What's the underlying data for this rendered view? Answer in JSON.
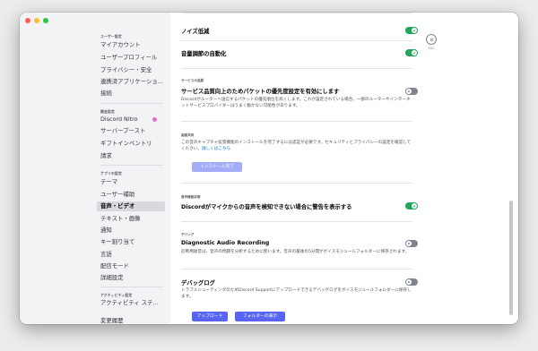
{
  "sidebar": {
    "user_settings_header": "ユーザー設定",
    "user_items": [
      "マイアカウント",
      "ユーザープロフィール",
      "プライバシー・安全",
      "連携済アプリケーショ...",
      "接続"
    ],
    "billing_header": "課金設定",
    "billing_items": [
      "Discord Nitro",
      "サーバーブースト",
      "ギフトインベントリ",
      "請求"
    ],
    "app_header": "アプリの設定",
    "app_items": [
      "テーマ",
      "ユーザー補助",
      "音声・ビデオ",
      "テキスト・画像",
      "通知",
      "キー割り当て",
      "言語",
      "配信モード",
      "詳細設定"
    ],
    "activity_header": "アクティビティ設定",
    "activity_items": [
      "アクティビティ ステ..."
    ],
    "bottom_item": "変更履歴"
  },
  "settings": {
    "noise_reduction": "ノイズ低減",
    "auto_gain": "音量調節の自動化",
    "qos_header": "サービスの品質",
    "qos_title": "サービス品質向上のためパケットの優先度設定を有効にします",
    "qos_desc": "Discordがルーターへ送信するパケットの優先順位を高くします。これが設定されている場合、一部のルーターやインターネットサービスプロバイダーはうまく動かない可能性があります。",
    "capture_header": "画面共有",
    "capture_desc": "この音声キャプチャ拡張機能のインストールを完了するには認証が必要です。セキュリティとプライバシーの設定を確認してください。",
    "capture_link": "詳しくはこちら",
    "install_button": "インストール完了",
    "diag_header": "音声機能診断",
    "diag_title": "Discordがマイクからの音声を検知できない場合に警告を表示する",
    "debug_header": "デバッグ",
    "diag_rec_title": "Diagnostic Audio Recording",
    "diag_rec_desc": "診断用録音は、音声の問題を分析するために使います。音声の最後の5分間がボイスモジュールフォルダーに保存されます。",
    "debug_log_title": "デバッグログ",
    "debug_log_desc": "トラブルシューティングのためDiscord Supportにアップロードできるデバッグログをボイスモジュールフォルダーに保存します。",
    "upload_button": "アップロード",
    "show_folder_button": "フォルダーの表示"
  },
  "toggles": {
    "noise_reduction": true,
    "auto_gain": true,
    "qos": false,
    "diag_warning": true,
    "diag_recording": false,
    "debug_log": false
  },
  "close": {
    "esc_label": "ESC"
  },
  "colors": {
    "toggle_on": "#23a55a",
    "toggle_off": "#80848e",
    "accent": "#5865f2",
    "selected_bg": "#d7d9dc"
  }
}
